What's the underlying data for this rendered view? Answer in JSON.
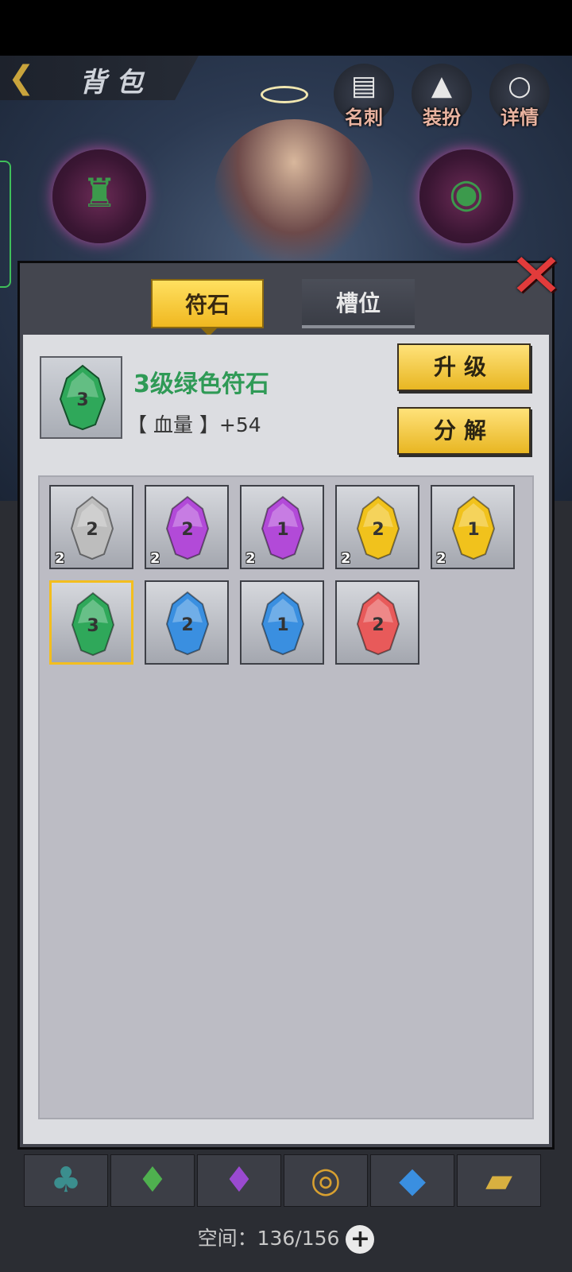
{
  "header": {
    "title": "背包",
    "back_icon": "back-chevron-icon"
  },
  "top_actions": [
    {
      "label": "名刺",
      "icon": "business-card-icon"
    },
    {
      "label": "装扮",
      "icon": "hooded-figure-icon"
    },
    {
      "label": "详情",
      "icon": "magnifier-icon"
    }
  ],
  "modal": {
    "tabs": [
      {
        "label": "符石",
        "active": true
      },
      {
        "label": "槽位",
        "active": false
      }
    ],
    "close_icon": "close-x-icon",
    "selected": {
      "name": "3级绿色符石",
      "stat": "【 血量 】+54",
      "level": "3",
      "color": "#2fa85a"
    },
    "buttons": {
      "upgrade": "升级",
      "decompose": "分解"
    },
    "items": [
      {
        "level": "2",
        "count": "2",
        "color": "#bdbdbd",
        "name": "gray"
      },
      {
        "level": "2",
        "count": "2",
        "color": "#b24ad8",
        "name": "purple"
      },
      {
        "level": "1",
        "count": "2",
        "color": "#b24ad8",
        "name": "purple"
      },
      {
        "level": "2",
        "count": "2",
        "color": "#f1c21c",
        "name": "yellow"
      },
      {
        "level": "1",
        "count": "2",
        "color": "#f1c21c",
        "name": "yellow"
      },
      {
        "level": "3",
        "count": "",
        "color": "#2fa85a",
        "name": "green",
        "selected": true
      },
      {
        "level": "2",
        "count": "",
        "color": "#3a8fe0",
        "name": "blue"
      },
      {
        "level": "1",
        "count": "",
        "color": "#3a8fe0",
        "name": "blue"
      },
      {
        "level": "2",
        "count": "",
        "color": "#e85a5a",
        "name": "red"
      }
    ]
  },
  "footer": {
    "space_label": "空间：",
    "space_value": "136/156",
    "plus_label": "+"
  }
}
